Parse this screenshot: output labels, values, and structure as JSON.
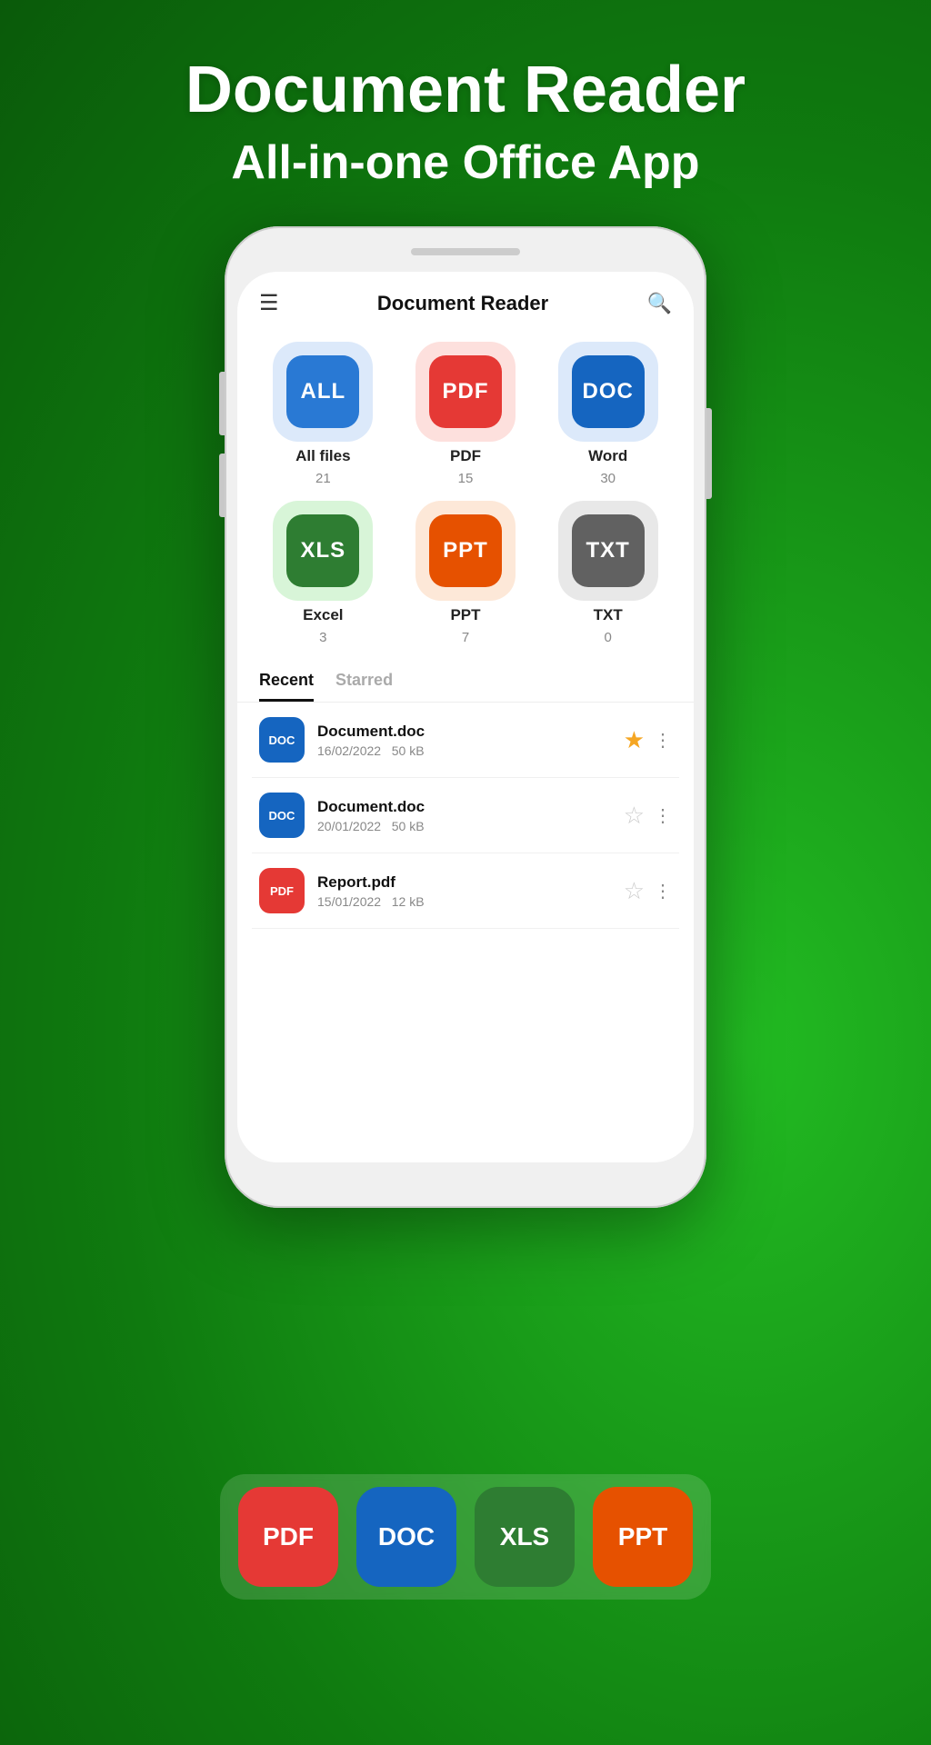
{
  "hero": {
    "title": "Document Reader",
    "subtitle": "All-in-one Office App"
  },
  "app": {
    "title": "Document Reader"
  },
  "icons": {
    "hamburger": "☰",
    "search": "⌕"
  },
  "fileTypes": [
    {
      "id": "all",
      "label": "All files",
      "count": "21",
      "text": "ALL",
      "bgColor": "#dce9fa",
      "iconColor": "#2979d4"
    },
    {
      "id": "pdf",
      "label": "PDF",
      "count": "15",
      "text": "PDF",
      "bgColor": "#fde0dd",
      "iconColor": "#e53935"
    },
    {
      "id": "doc",
      "label": "Word",
      "count": "30",
      "text": "DOC",
      "bgColor": "#dce9fa",
      "iconColor": "#1565c0"
    },
    {
      "id": "xls",
      "label": "Excel",
      "count": "3",
      "text": "XLS",
      "bgColor": "#d8f5d8",
      "iconColor": "#2e7d32"
    },
    {
      "id": "ppt",
      "label": "PPT",
      "count": "7",
      "text": "PPT",
      "bgColor": "#fde8d8",
      "iconColor": "#e65100"
    },
    {
      "id": "txt",
      "label": "TXT",
      "count": "0",
      "text": "TXT",
      "bgColor": "#e8e8e8",
      "iconColor": "#616161"
    }
  ],
  "tabs": [
    {
      "id": "recent",
      "label": "Recent",
      "active": true
    },
    {
      "id": "starred",
      "label": "Starred",
      "active": false
    }
  ],
  "recentFiles": [
    {
      "id": "1",
      "name": "Document.doc",
      "date": "16/02/2022",
      "size": "50 kB",
      "type": "DOC",
      "iconColor": "#1565c0",
      "starred": true
    },
    {
      "id": "2",
      "name": "Document.doc",
      "date": "20/01/2022",
      "size": "50 kB",
      "type": "DOC",
      "iconColor": "#1565c0",
      "starred": false
    },
    {
      "id": "3",
      "name": "Report.pdf",
      "date": "15/01/2022",
      "size": "12 kB",
      "type": "PDF",
      "iconColor": "#e53935",
      "starred": false
    }
  ],
  "banner": {
    "items": [
      {
        "text": "PDF",
        "color": "#e53935"
      },
      {
        "text": "DOC",
        "color": "#1565c0"
      },
      {
        "text": "XLS",
        "color": "#2e7d32"
      },
      {
        "text": "PPT",
        "color": "#e65100"
      }
    ]
  }
}
